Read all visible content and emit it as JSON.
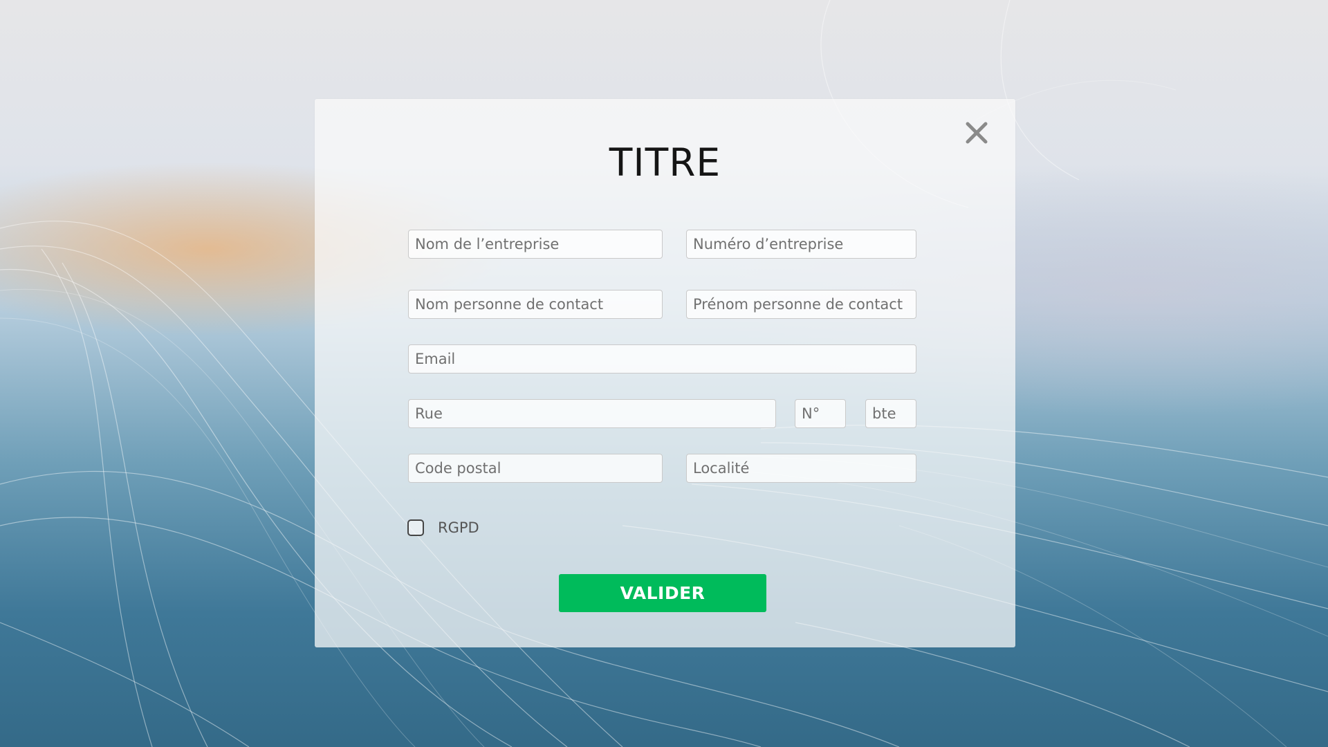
{
  "colors": {
    "accent": "#00bb5b",
    "panel": "#fafafa",
    "field_border": "#c9c9c9",
    "close_icon": "#8a8a8a"
  },
  "modal": {
    "title": "TITRE",
    "close_icon": "close-icon",
    "fields": {
      "company_name": "Nom de l’entreprise",
      "company_number": "Numéro d’entreprise",
      "contact_last_name": "Nom personne de contact",
      "contact_first_name": "Prénom personne de contact",
      "email": "Email",
      "street": "Rue",
      "house_number": "N°",
      "box": "bte",
      "postal_code": "Code postal",
      "city": "Localité"
    },
    "rgpd": {
      "label": "RGPD",
      "checked": false
    },
    "submit_label": "VALIDER"
  }
}
